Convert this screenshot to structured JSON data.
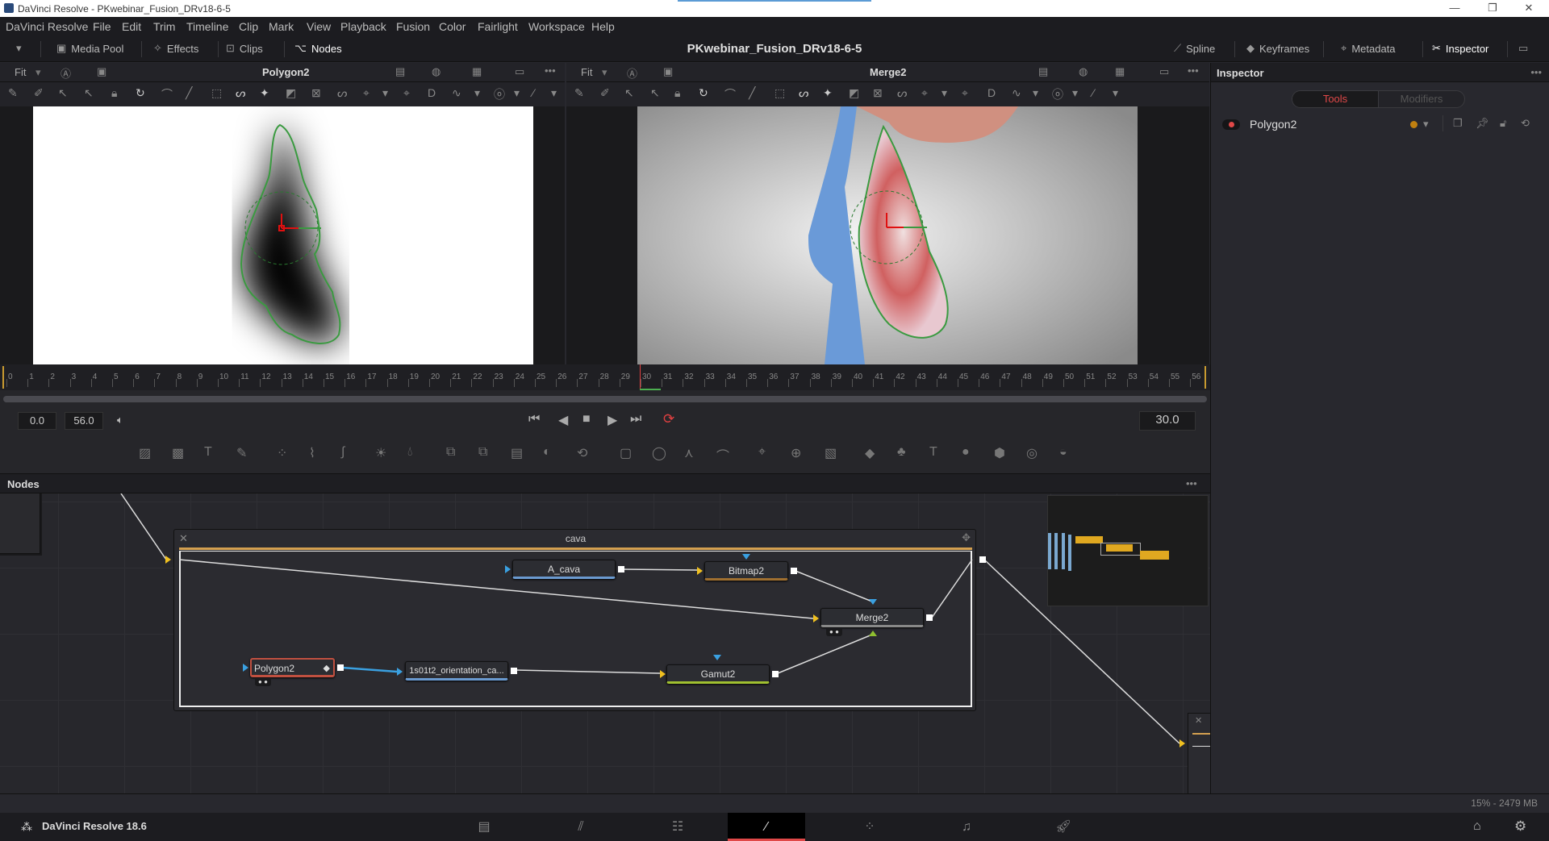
{
  "window": {
    "title": "DaVinci Resolve - PKwebinar_Fusion_DRv18-6-5",
    "minimize": "—",
    "maximize": "❐",
    "close": "✕"
  },
  "menu": [
    "DaVinci Resolve",
    "File",
    "Edit",
    "Trim",
    "Timeline",
    "Clip",
    "Mark",
    "View",
    "Playback",
    "Fusion",
    "Color",
    "Fairlight",
    "Workspace",
    "Help"
  ],
  "toolbar": {
    "media_pool": "Media Pool",
    "effects": "Effects",
    "clips": "Clips",
    "nodes": "Nodes",
    "project_title": "PKwebinar_Fusion_DRv18-6-5",
    "spline": "Spline",
    "keyframes": "Keyframes",
    "metadata": "Metadata",
    "inspector": "Inspector"
  },
  "viewer_left": {
    "zoom": "Fit",
    "name": "Polygon2"
  },
  "viewer_right": {
    "zoom": "Fit",
    "name": "Merge2"
  },
  "inspector": {
    "title": "Inspector",
    "tabs": [
      "Tools",
      "Modifiers"
    ],
    "active_tab": "Tools",
    "tool_name": "Polygon2",
    "accent": "#e04848"
  },
  "timeline": {
    "ticks": [
      "0",
      "1",
      "2",
      "3",
      "4",
      "5",
      "6",
      "7",
      "8",
      "9",
      "10",
      "11",
      "12",
      "13",
      "14",
      "15",
      "16",
      "17",
      "18",
      "19",
      "20",
      "21",
      "22",
      "23",
      "24",
      "25",
      "26",
      "27",
      "28",
      "29",
      "30",
      "31",
      "32",
      "33",
      "34",
      "35",
      "36",
      "37",
      "38",
      "39",
      "40",
      "41",
      "42",
      "43",
      "44",
      "45",
      "46",
      "47",
      "48",
      "49",
      "50",
      "51",
      "52",
      "53",
      "54",
      "55",
      "56"
    ],
    "current_frame": "30.0",
    "start": "0.0",
    "end": "56.0",
    "playhead_frame": 30
  },
  "nodes_panel": {
    "title": "Nodes",
    "group_name": "cava",
    "nodes": {
      "a_cava": "A_cava",
      "bitmap": "Bitmap2",
      "merge": "Merge2",
      "polygon": "Polygon2",
      "orientation": "1s01t2_orientation_ca...",
      "gamut": "Gamut2"
    }
  },
  "status": {
    "memory": "15% - 2479 MB"
  },
  "app": {
    "name": "DaVinci Resolve 18.6"
  },
  "pages": [
    "media",
    "cut",
    "edit",
    "fusion",
    "color",
    "fairlight",
    "deliver"
  ],
  "active_page": "fusion"
}
